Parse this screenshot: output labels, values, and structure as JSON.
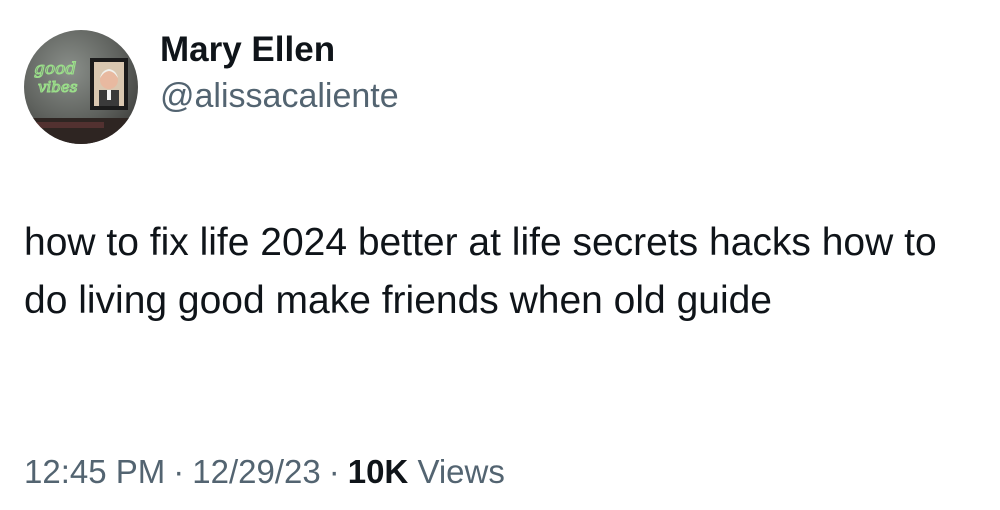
{
  "tweet": {
    "author": {
      "display_name": "Mary Ellen",
      "handle": "@alissacaliente",
      "avatar_sign_text": "good vibes"
    },
    "text": "how to fix life 2024 better at life secrets hacks how to do living good make friends when old guide",
    "meta": {
      "time": "12:45 PM",
      "separator": "·",
      "date": "12/29/23",
      "views_count": "10K",
      "views_label": "Views"
    }
  },
  "colors": {
    "primary_text": "#0f1419",
    "secondary_text": "#536471",
    "background": "#ffffff",
    "neon_green": "#9be08a"
  }
}
